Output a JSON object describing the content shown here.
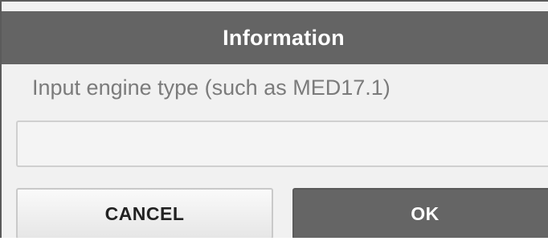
{
  "dialog": {
    "title": "Information",
    "message": "Input engine type (such as MED17.1)",
    "input": {
      "value": "",
      "placeholder": ""
    },
    "buttons": {
      "cancel_label": "CANCEL",
      "ok_label": "OK"
    }
  },
  "colors": {
    "title_bar": "#646464",
    "ok_button": "#656565",
    "cancel_button": "#eeeeee",
    "message_text": "#7b7b7b"
  }
}
